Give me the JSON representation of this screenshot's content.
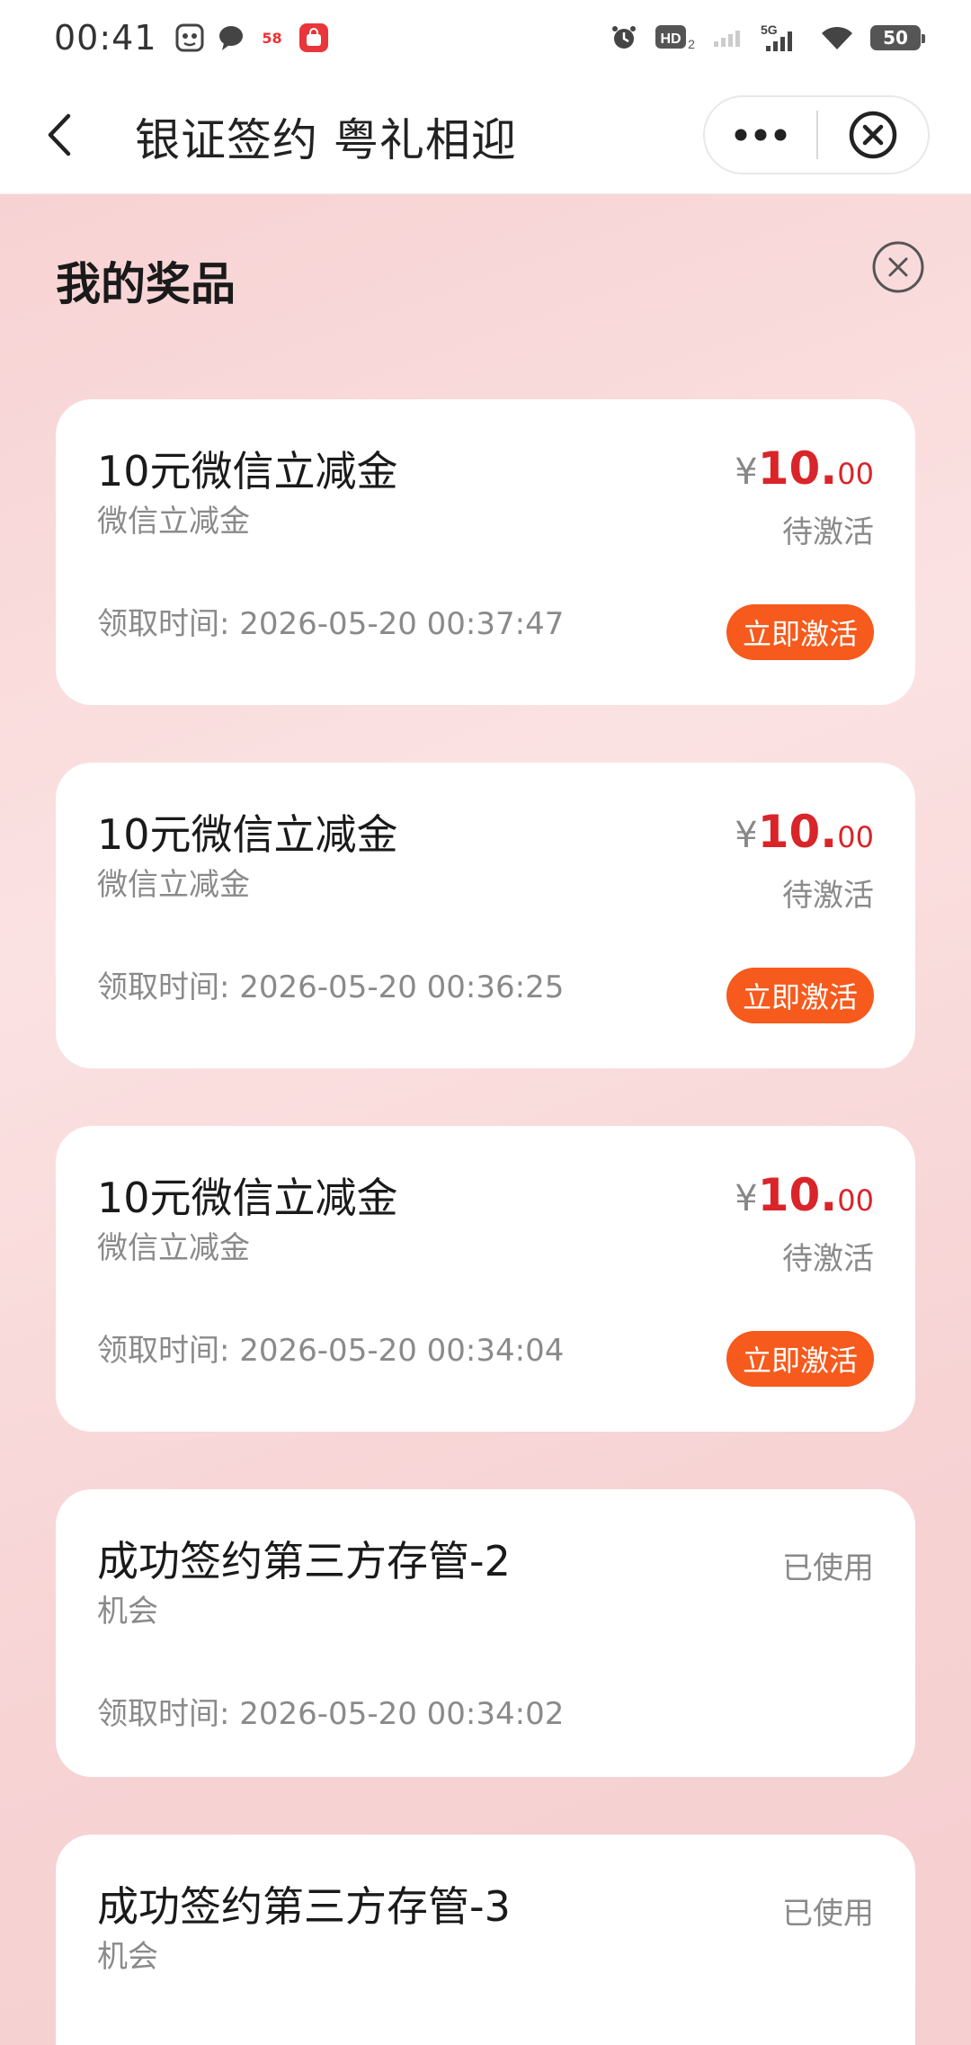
{
  "status_bar": {
    "time": "00:41",
    "badge_58": "58",
    "network": "5G",
    "battery": "50",
    "hd": "HD"
  },
  "nav": {
    "title": "银证签约 粤礼相迎"
  },
  "section": {
    "title": "我的奖品"
  },
  "prizes": [
    {
      "name": "10元微信立减金",
      "subtitle": "微信立减金",
      "time": "领取时间: 2026-05-20 00:37:47",
      "price_symbol": "¥",
      "price_int": "10.",
      "price_dec": "00",
      "status": "待激活",
      "action": "立即激活"
    },
    {
      "name": "10元微信立减金",
      "subtitle": "微信立减金",
      "time": "领取时间: 2026-05-20 00:36:25",
      "price_symbol": "¥",
      "price_int": "10.",
      "price_dec": "00",
      "status": "待激活",
      "action": "立即激活"
    },
    {
      "name": "10元微信立减金",
      "subtitle": "微信立减金",
      "time": "领取时间: 2026-05-20 00:34:04",
      "price_symbol": "¥",
      "price_int": "10.",
      "price_dec": "00",
      "status": "待激活",
      "action": "立即激活"
    },
    {
      "name": "成功签约第三方存管-2",
      "subtitle": "机会",
      "time": "领取时间: 2026-05-20 00:34:02",
      "status": "已使用"
    },
    {
      "name": "成功签约第三方存管-3",
      "subtitle": "机会",
      "status": "已使用"
    }
  ],
  "colors": {
    "accent_red": "#d9252a",
    "activate_orange": "#f65a1c",
    "background_pink": "#f8d7d8"
  },
  "icons": [
    "back-arrow-icon",
    "more-dots-icon",
    "close-circle-icon",
    "panel-close-icon"
  ]
}
